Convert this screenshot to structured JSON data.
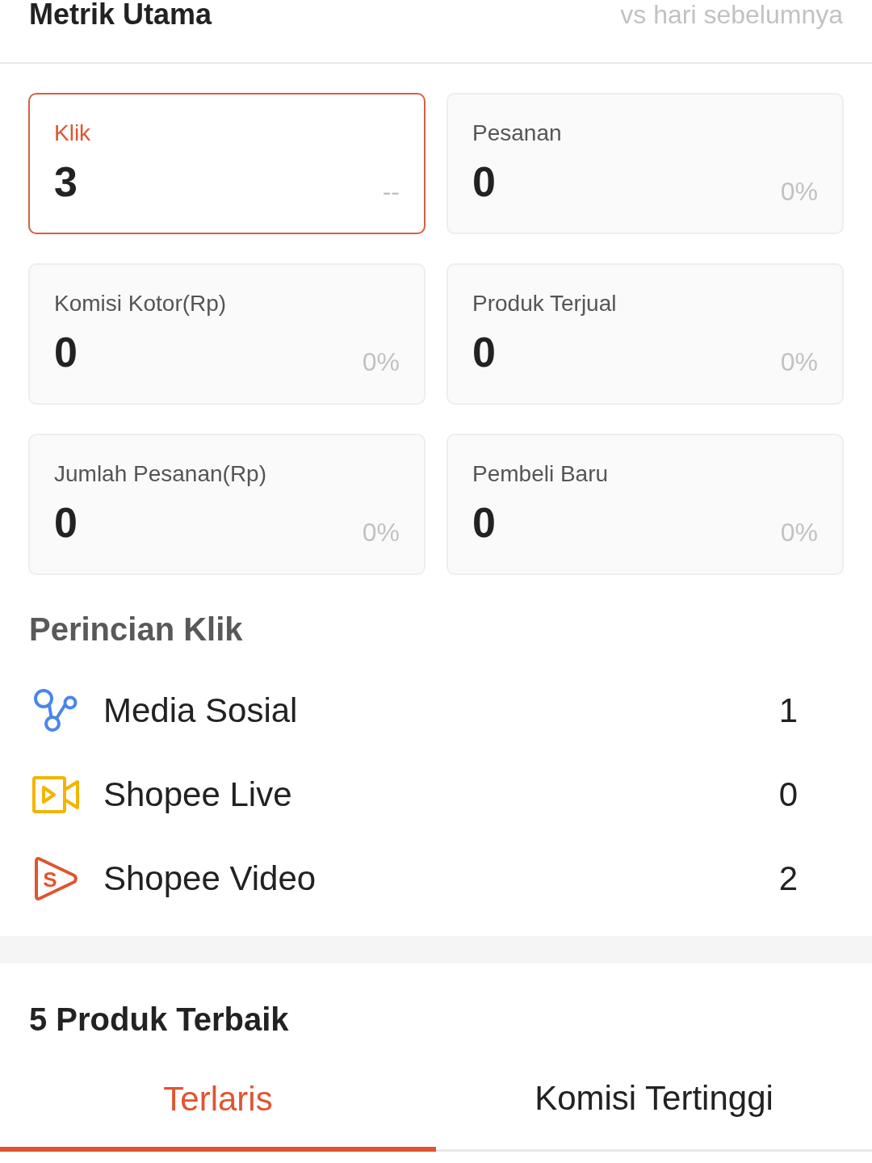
{
  "header": {
    "title": "Metrik Utama",
    "comparison": "vs hari sebelumnya"
  },
  "metrics": [
    {
      "label": "Klik",
      "value": "3",
      "change": "--",
      "selected": true
    },
    {
      "label": "Pesanan",
      "value": "0",
      "change": "0%",
      "selected": false
    },
    {
      "label": "Komisi Kotor(Rp)",
      "value": "0",
      "change": "0%",
      "selected": false
    },
    {
      "label": "Produk Terjual",
      "value": "0",
      "change": "0%",
      "selected": false
    },
    {
      "label": "Jumlah Pesanan(Rp)",
      "value": "0",
      "change": "0%",
      "selected": false
    },
    {
      "label": "Pembeli Baru",
      "value": "0",
      "change": "0%",
      "selected": false
    }
  ],
  "click_breakdown": {
    "title": "Perincian Klik",
    "items": [
      {
        "kind": "social",
        "label": "Media Sosial",
        "count": "1"
      },
      {
        "kind": "live",
        "label": "Shopee Live",
        "count": "0"
      },
      {
        "kind": "video",
        "label": "Shopee Video",
        "count": "2",
        "icon_letter": "S"
      }
    ]
  },
  "top_products": {
    "title": "5 Produk Terbaik",
    "tabs": [
      {
        "label": "Terlaris",
        "selected": true
      },
      {
        "label": "Komisi Tertinggi",
        "selected": false
      }
    ]
  }
}
